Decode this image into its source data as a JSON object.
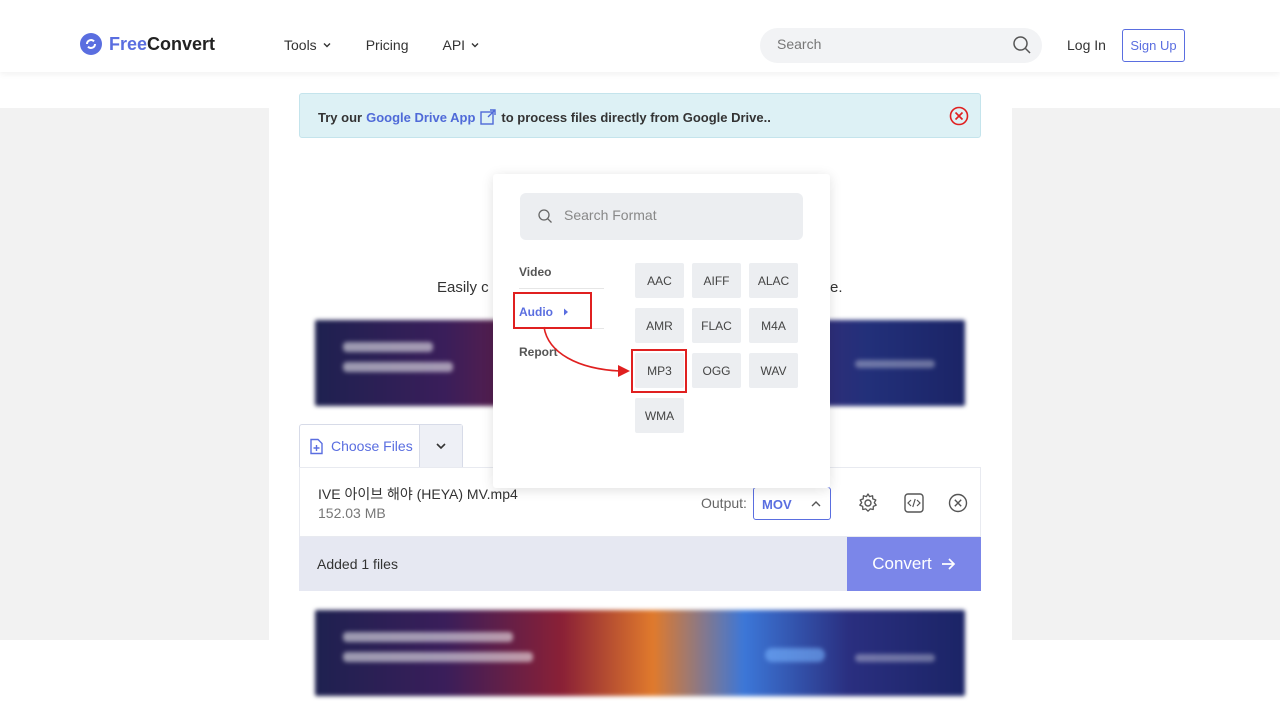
{
  "header": {
    "logo_free": "Free",
    "logo_convert": "Convert",
    "nav": [
      {
        "label": "Tools",
        "has_dropdown": true
      },
      {
        "label": "Pricing",
        "has_dropdown": false
      },
      {
        "label": "API",
        "has_dropdown": true
      }
    ],
    "search_placeholder": "Search",
    "login": "Log In",
    "signup": "Sign Up"
  },
  "notice": {
    "prefix": "Try our",
    "link": "Google Drive App",
    "suffix": "to process files directly from Google Drive.."
  },
  "tagline": {
    "left": "Easily c",
    "right": "e."
  },
  "upload": {
    "choose_files": "Choose Files"
  },
  "file": {
    "name": "IVE 아이브 해야 (HEYA) MV.mp4",
    "size": "152.03 MB",
    "output_label": "Output:",
    "output_value": "MOV"
  },
  "bar": {
    "added": "Added 1 files",
    "convert": "Convert"
  },
  "format_popup": {
    "search_placeholder": "Search Format",
    "categories": [
      {
        "label": "Video",
        "active": false
      },
      {
        "label": "Audio",
        "active": true
      },
      {
        "label": "Report",
        "active": false
      }
    ],
    "formats": [
      "AAC",
      "AIFF",
      "ALAC",
      "AMR",
      "FLAC",
      "M4A",
      "MP3",
      "OGG",
      "WAV",
      "WMA"
    ],
    "highlighted": "MP3"
  },
  "colors": {
    "brand": "#5a6ee0",
    "convert_button": "#7b86e9",
    "annotation_red": "#e02020",
    "notice_bg": "#ddf1f5"
  }
}
